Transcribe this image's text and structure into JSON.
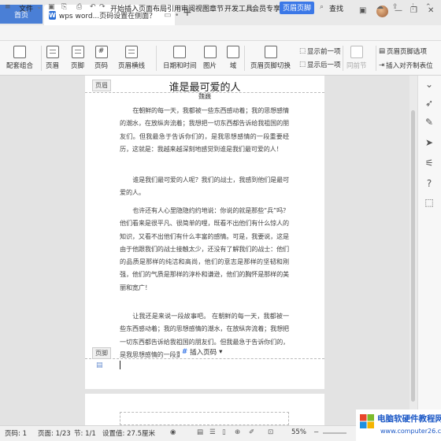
{
  "tabs": {
    "home_label": "首页",
    "doc_label": "wps word...页码设置在侧面？",
    "doc_icon": "W"
  },
  "menu": {
    "file_label": "文件",
    "items": [
      "开始",
      "插入",
      "页面布局",
      "引用",
      "审阅",
      "视图",
      "章节",
      "开发工具",
      "会员专享"
    ],
    "active": "页眉页脚",
    "search": "查找"
  },
  "ribbon": {
    "config_combo": "配套组合",
    "header": "页眉",
    "footer": "页脚",
    "page_number": "页码",
    "header_hline": "页眉横线",
    "date_time": "日期和时间",
    "picture": "图片",
    "field": "域",
    "switch_hf": "页眉页脚切换",
    "show_prev": "显示前一项",
    "show_next": "显示后一项",
    "same_as_prev": "同前节",
    "hf_options": "页眉页脚选项",
    "insert_align_tab": "插入对齐制表位"
  },
  "document": {
    "header_tag": "页眉",
    "footer_tag": "页脚",
    "title": "谁是最可爱的人",
    "author": "魏巍",
    "paragraphs": [
      "在朝鲜的每一天，我都被一些东西感动着；我的思想感情的潮水，在放纵奔流着；我想把一切东西都告诉给我祖国的朋友们。但我最急于告诉你们的，是我思想感情的一段重要经历，这就是：我越来越深刻地感觉到谁是我们最可爱的人！",
      "谁是我们最可爱的人呢？我们的战士，我感到他们是最可爱的人。",
      "也许还有人心里隐隐约约地说：你说的就是那些“兵”吗？他们看来是很平凡、很简单的哩，既看不出他们有什么惊人的知识，又看不出他们有什么丰富的感情。可是，我要说，这是由于他跟我们的战士接触太少，还没有了解我们的战士：他们的品质是那样的纯洁和高尚，他们的意志是那样的坚韧和刚强，他们的气质是那样的淳朴和谦逊，他们的胸怀是那样的美丽和宽广！",
      "让我还是来说一段故事吧。 在朝鲜的每一天，我都被一些东西感动着；我的思想感情的潮水，在放纵奔流着；我想把一切东西都告诉给我祖国的朋友们。但我最急于告诉你们的，是我思想感情的一段重要经"
    ],
    "insert_page_number": "插入页码"
  },
  "status": {
    "page": "页码: 1",
    "pages": "页面: 1/23",
    "section": "节: 1/1",
    "settings": "设置值: 27.5厘米",
    "zoom": "55%"
  },
  "watermark": {
    "line1": "电脑软硬件教程网",
    "line2": "www.computer26.com"
  },
  "colors": {
    "accent": "#3b78e7",
    "home_tab": "#4a7fd6"
  }
}
